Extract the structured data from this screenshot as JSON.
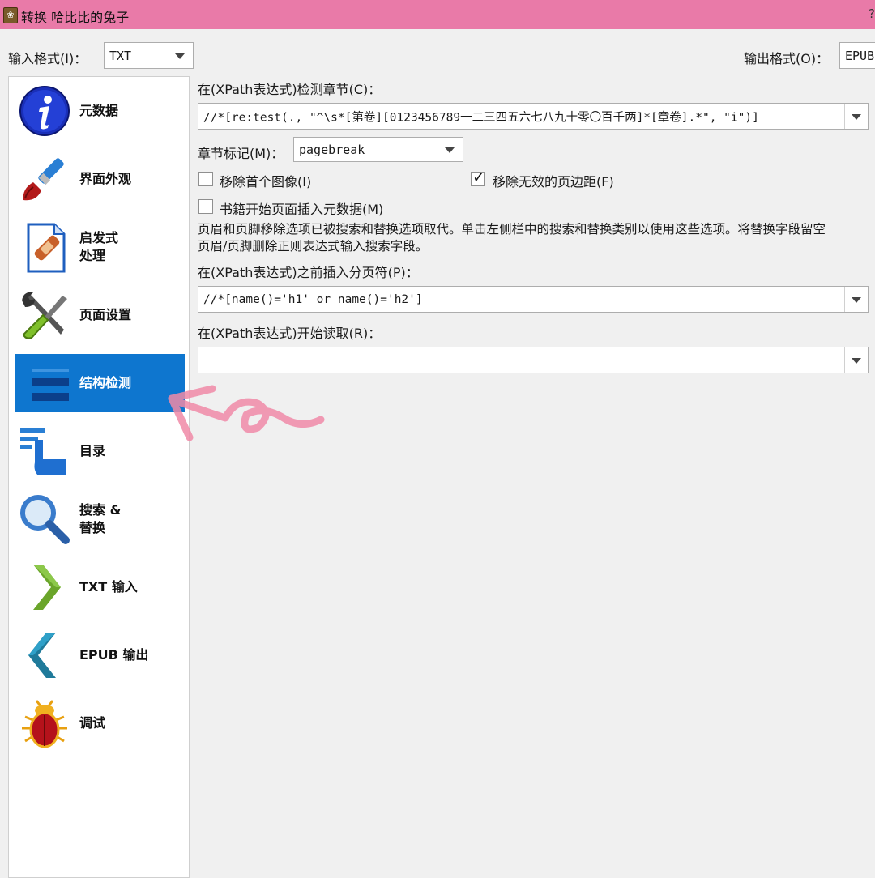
{
  "titlebar": {
    "title": "转换 哈比比的兔子",
    "help": "?"
  },
  "top": {
    "input_format_label": "输入格式(I)：",
    "input_format_value": "TXT",
    "output_format_label": "输出格式(O)：",
    "output_format_value": "EPUB"
  },
  "sidebar": {
    "items": [
      {
        "label": "元数据",
        "icon": "info-icon"
      },
      {
        "label": "界面外观",
        "icon": "paintbrush-icon"
      },
      {
        "label": "启发式\n处理",
        "icon": "heuristics-document-icon"
      },
      {
        "label": "页面设置",
        "icon": "wrench-screwdriver-icon"
      },
      {
        "label": "结构检测",
        "icon": "structure-lines-icon",
        "active": true
      },
      {
        "label": "目录",
        "icon": "toc-hand-icon"
      },
      {
        "label": "搜索 &\n替换",
        "icon": "magnifier-icon"
      },
      {
        "label": "TXT 输入",
        "icon": "chevron-right-icon"
      },
      {
        "label": "EPUB 输出",
        "icon": "chevron-left-icon"
      },
      {
        "label": "调试",
        "icon": "bug-icon"
      }
    ]
  },
  "structure": {
    "chapter_label": "在(XPath表达式)检测章节(C)：",
    "chapter_xpath": "//*[re:test(., \"^\\s*[第卷][0123456789一二三四五六七八九十零〇百千两]*[章卷].*\", \"i\")]",
    "chapter_mark_label": "章节标记(M)：",
    "chapter_mark_value": "pagebreak",
    "remove_first_image_label": "移除首个图像(I)",
    "remove_first_image_checked": false,
    "remove_fake_margins_label": "移除无效的页边距(F)",
    "remove_fake_margins_checked": true,
    "insert_metadata_label": "书籍开始页面插入元数据(M)",
    "insert_metadata_checked": false,
    "note_line1": "页眉和页脚移除选项已被搜索和替换选项取代。单击左侧栏中的搜索和替换类别以使用这些选项。将替换字段留空",
    "note_line2": "页眉/页脚删除正则表达式输入搜索字段。",
    "page_break_label": "在(XPath表达式)之前插入分页符(P)：",
    "page_break_xpath": "//*[name()='h1' or name()='h2']",
    "start_reading_label": "在(XPath表达式)开始读取(R)：",
    "start_reading_xpath": ""
  },
  "colors": {
    "titlebar": "#e97aa8",
    "active_item": "#0e76cf",
    "annotation": "#f08aa8"
  }
}
